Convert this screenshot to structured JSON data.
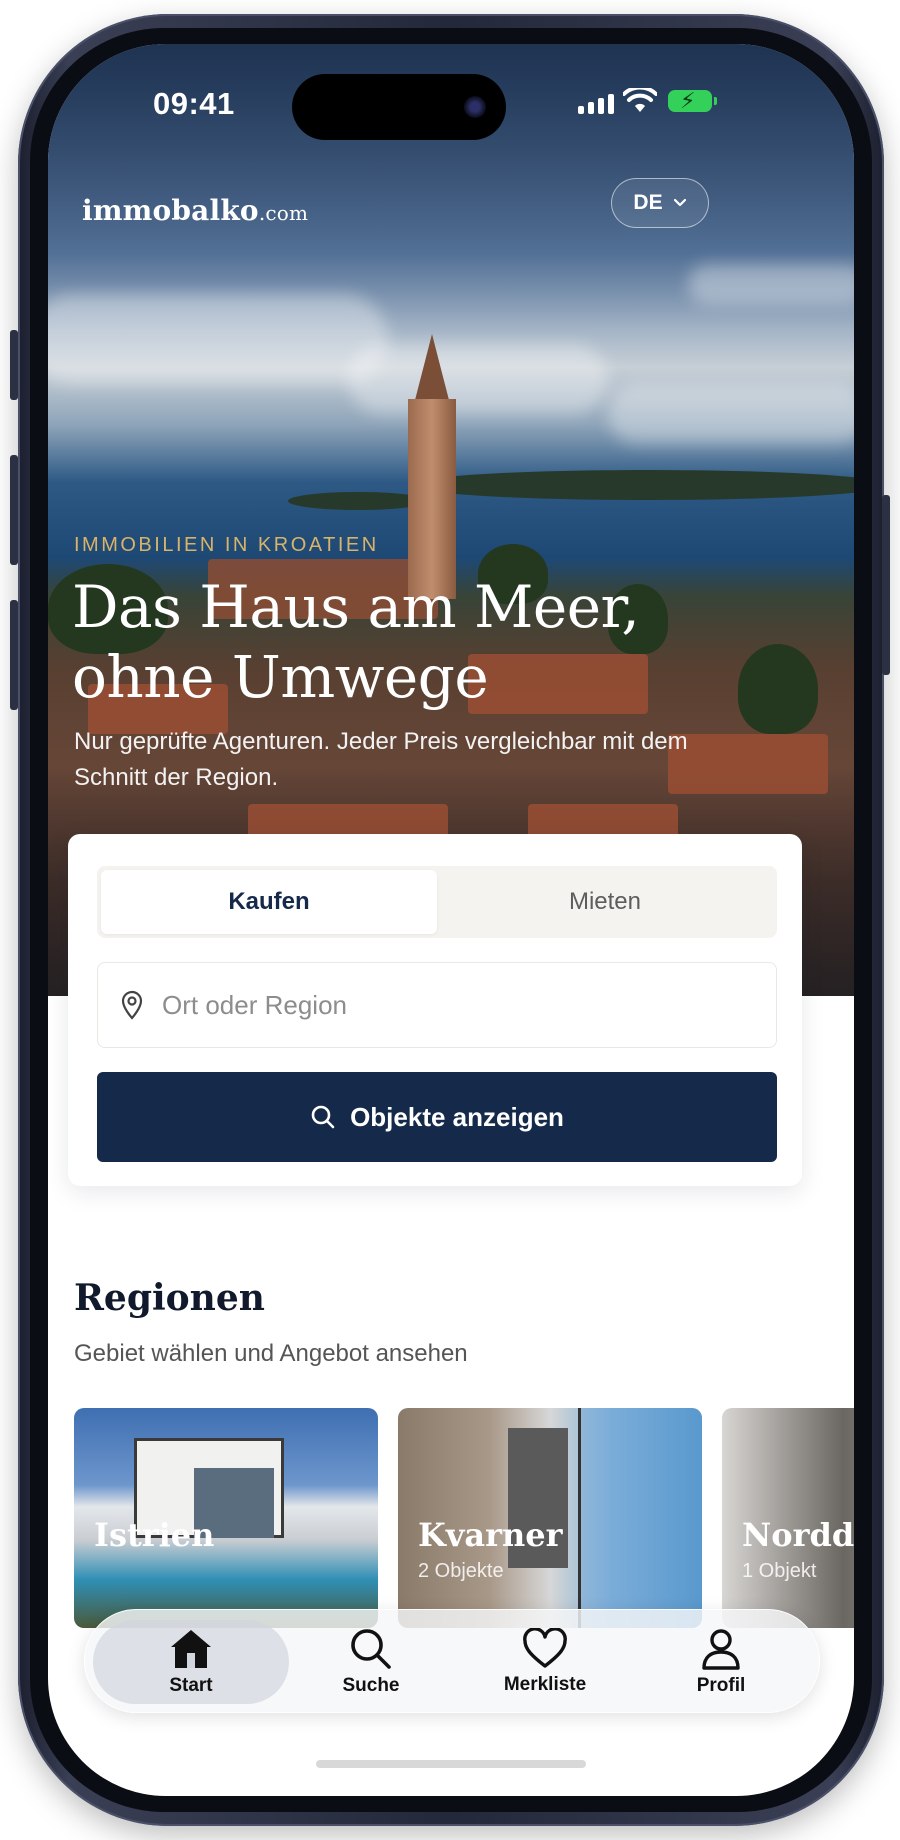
{
  "status_bar": {
    "time": "09:41"
  },
  "header": {
    "logo_main": "immobalko",
    "logo_suffix": ".com",
    "language": "DE"
  },
  "hero": {
    "eyebrow": "IMMOBILIEN IN KROATIEN",
    "title": "Das Haus am Meer, ohne Umwege",
    "subtitle": "Nur geprüfte Agenturen. Jeder Preis vergleichbar mit dem Schnitt der Region."
  },
  "search": {
    "tabs": [
      {
        "label": "Kaufen",
        "active": true
      },
      {
        "label": "Mieten",
        "active": false
      }
    ],
    "location_placeholder": "Ort oder Region",
    "submit_label": "Objekte anzeigen"
  },
  "regions": {
    "title": "Regionen",
    "subtitle": "Gebiet wählen und Angebot ansehen",
    "items": [
      {
        "name": "Istrien",
        "count": ""
      },
      {
        "name": "Kvarner",
        "count": "2 Objekte"
      },
      {
        "name": "Nordd",
        "count": "1 Objekt"
      }
    ]
  },
  "tabbar": {
    "items": [
      {
        "label": "Start",
        "icon": "home-icon",
        "active": true
      },
      {
        "label": "Suche",
        "icon": "search-icon",
        "active": false
      },
      {
        "label": "Merkliste",
        "icon": "heart-icon",
        "active": false
      },
      {
        "label": "Profil",
        "icon": "user-icon",
        "active": false
      }
    ]
  },
  "colors": {
    "navy": "#15294a",
    "gold": "#d8b36a",
    "segment_bg": "#f5f3ef"
  }
}
